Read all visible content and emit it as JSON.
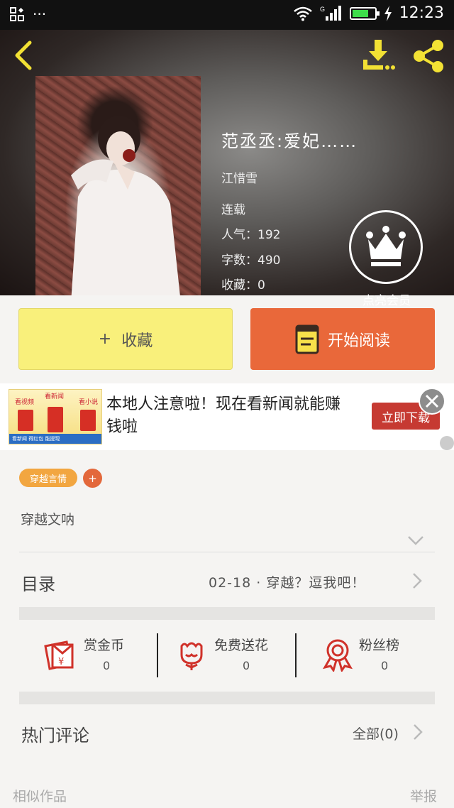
{
  "status_bar": {
    "time": "12:23",
    "left_icons": [
      "app-grid-icon",
      "more-icon"
    ],
    "right_icons": [
      "wifi-icon",
      "signal-icon",
      "battery-icon",
      "charging-icon"
    ],
    "network_badge": "G",
    "overflow_dots": "···",
    "battery_level": 0.7
  },
  "header": {
    "book_title": "范丞丞:爱妃……",
    "author": "江惜雪",
    "status": "连载",
    "popularity": "人气：192",
    "word_count": "字数：490",
    "favorites": "收藏：0",
    "vip_label": "点亮会员",
    "icons": [
      "back-arrow-icon",
      "download-icon",
      "share-icon",
      "crown-icon"
    ]
  },
  "actions": {
    "collect_icon": "+",
    "collect_label": "收藏",
    "read_label": "开始阅读"
  },
  "ad": {
    "text": "本地人注意啦！现在看新闻就能赚钱啦",
    "cta": "立即下载",
    "image_labels": [
      "看视频",
      "看新闻",
      "看小说"
    ],
    "image_footer": "看新闻 得红包 能提现"
  },
  "tags": {
    "genre": "穿越言情",
    "add_symbol": "+"
  },
  "description": "穿越文呐",
  "toc": {
    "label": "目录",
    "latest": "02-18 · 穿越？逗我吧！"
  },
  "stats": [
    {
      "name": "赏金币",
      "count": "0",
      "icon": "red-envelope-icon"
    },
    {
      "name": "免费送花",
      "count": "0",
      "icon": "flower-icon"
    },
    {
      "name": "粉丝榜",
      "count": "0",
      "icon": "medal-icon"
    }
  ],
  "comments": {
    "label": "热门评论",
    "all": "全部(0)"
  },
  "footer": {
    "similar": "相似作品",
    "report": "举报"
  },
  "colors": {
    "accent_orange": "#e9683a",
    "collect_yellow": "#f9f07b",
    "header_yellow": "#f2e134",
    "icon_red": "#d0322a"
  }
}
